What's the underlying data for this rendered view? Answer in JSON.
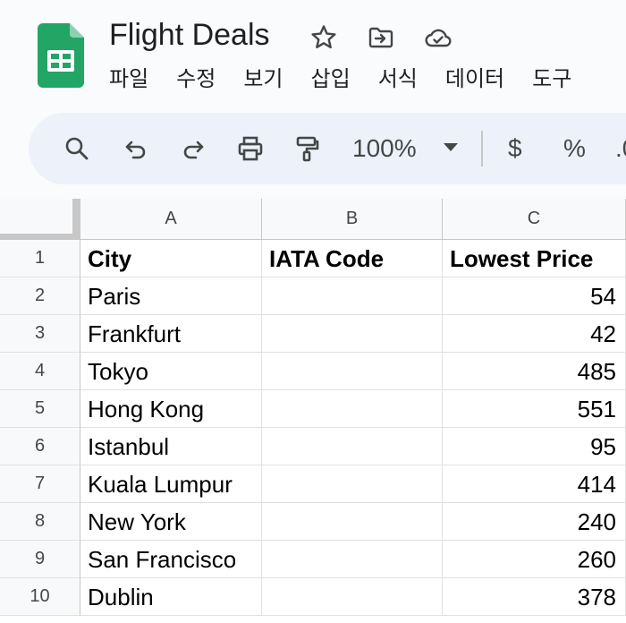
{
  "document": {
    "title": "Flight Deals"
  },
  "title_icons": [
    "star-icon",
    "move-to-folder-icon",
    "cloud-saved-icon"
  ],
  "menu": [
    "파일",
    "수정",
    "보기",
    "삽입",
    "서식",
    "데이터",
    "도구"
  ],
  "toolbar": {
    "icons": [
      "search-icon",
      "undo-icon",
      "redo-icon",
      "print-icon",
      "paint-format-icon"
    ],
    "zoom": "100%",
    "currency_label": "$",
    "percent_label": "%"
  },
  "colors": {
    "app_background": "#f9fbfd",
    "toolbar_background": "#edf2fa",
    "sheets_green": "#23a566"
  },
  "sheet": {
    "columns": [
      "A",
      "B",
      "C"
    ],
    "rows": [
      {
        "num": "1",
        "a": "City",
        "b": "IATA Code",
        "c": "Lowest Price"
      },
      {
        "num": "2",
        "a": "Paris",
        "b": "",
        "c": "54"
      },
      {
        "num": "3",
        "a": "Frankfurt",
        "b": "",
        "c": "42"
      },
      {
        "num": "4",
        "a": "Tokyo",
        "b": "",
        "c": "485"
      },
      {
        "num": "5",
        "a": "Hong Kong",
        "b": "",
        "c": "551"
      },
      {
        "num": "6",
        "a": "Istanbul",
        "b": "",
        "c": "95"
      },
      {
        "num": "7",
        "a": "Kuala Lumpur",
        "b": "",
        "c": "414"
      },
      {
        "num": "8",
        "a": "New York",
        "b": "",
        "c": "240"
      },
      {
        "num": "9",
        "a": "San Francisco",
        "b": "",
        "c": "260"
      },
      {
        "num": "10",
        "a": "Dublin",
        "b": "",
        "c": "378"
      }
    ]
  }
}
